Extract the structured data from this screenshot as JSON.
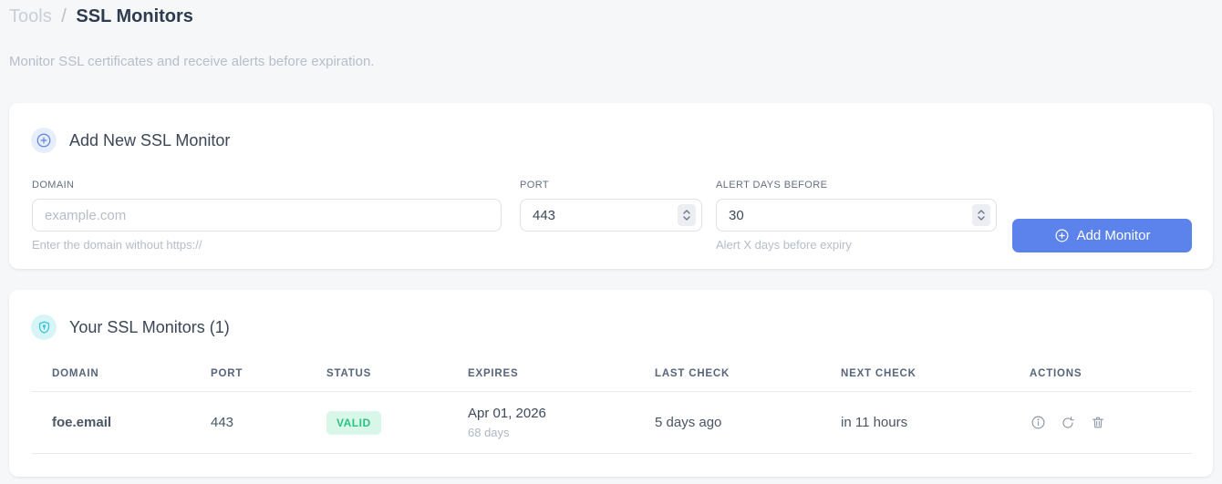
{
  "page": {
    "breadcrumb": {
      "parent": "Tools",
      "separator": "/",
      "current": "SSL Monitors"
    },
    "subtitle": "Monitor SSL certificates and receive alerts before expiration."
  },
  "add_monitor": {
    "title": "Add New SSL Monitor",
    "fields": {
      "domain": {
        "label": "DOMAIN",
        "placeholder": "example.com",
        "value": "",
        "helper": "Enter the domain without https://"
      },
      "port": {
        "label": "PORT",
        "value": "443"
      },
      "alert_days": {
        "label": "ALERT DAYS BEFORE",
        "value": "30",
        "helper": "Alert X days before expiry"
      }
    },
    "submit_label": "Add Monitor"
  },
  "monitors": {
    "title": "Your SSL Monitors (1)",
    "count": 1,
    "table": {
      "headers": [
        "DOMAIN",
        "PORT",
        "STATUS",
        "EXPIRES",
        "LAST CHECK",
        "NEXT CHECK",
        "ACTIONS"
      ],
      "rows": [
        {
          "domain": "foe.email",
          "port": "443",
          "status": "VALID",
          "expires_date": "Apr 01, 2026",
          "expires_days": "68 days",
          "last_check": "5 days ago",
          "next_check": "in 11 hours"
        }
      ]
    }
  },
  "icons": {
    "add_section": "plus-circle-icon",
    "list_section": "shield-icon",
    "actions": [
      "info-icon",
      "refresh-icon",
      "trash-icon"
    ]
  },
  "colors": {
    "accent_blue": "#5b83eb",
    "icon_cyan": "#36c5d8",
    "badge_green_bg": "#d9f7e8",
    "badge_green_text": "#2bc088",
    "link_blue": "#5b83eb",
    "page_bg": "#f6f7f9",
    "card_bg": "#ffffff"
  }
}
